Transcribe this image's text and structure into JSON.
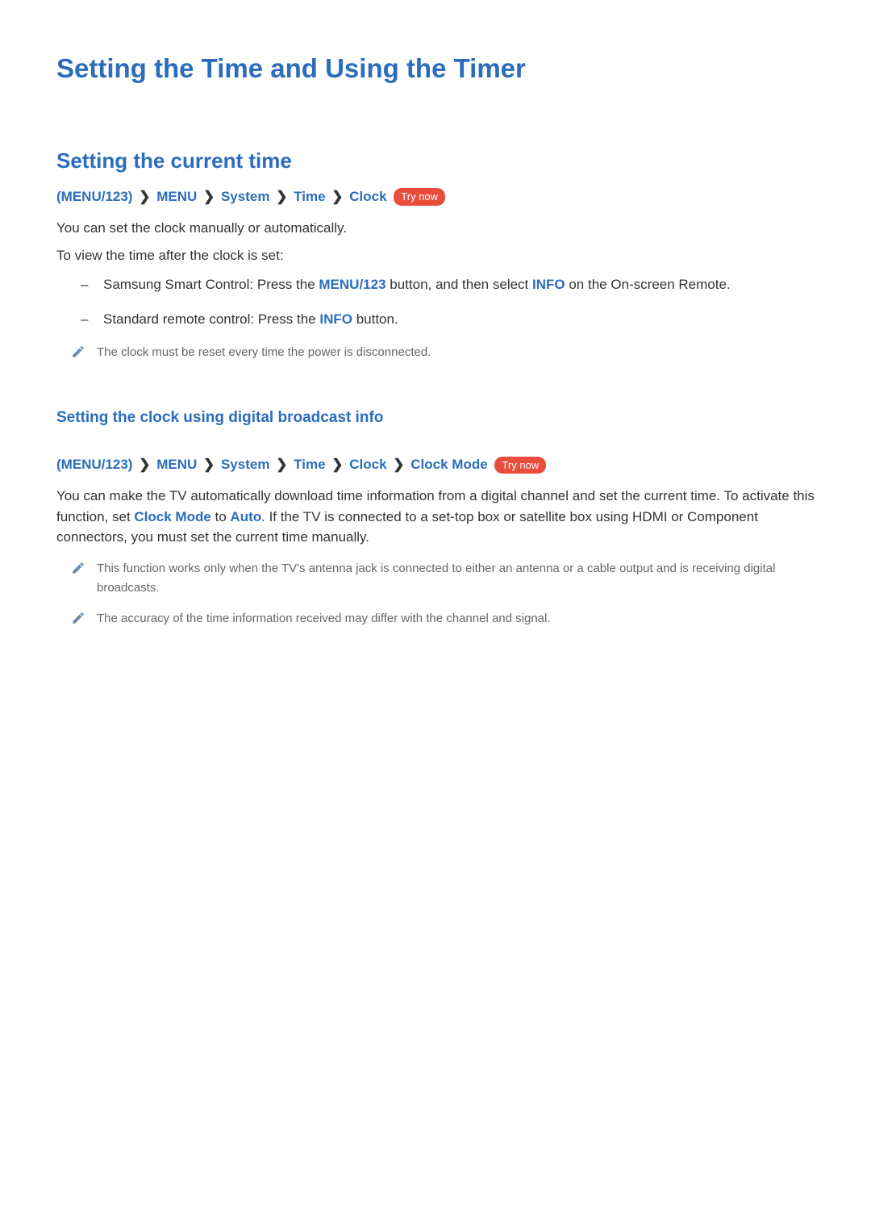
{
  "page": {
    "title": "Setting the Time and Using the Timer"
  },
  "section1": {
    "title": "Setting the current time",
    "breadcrumb": {
      "p1": "(MENU/123)",
      "p2": "MENU",
      "p3": "System",
      "p4": "Time",
      "p5": "Clock",
      "try_now": "Try now"
    },
    "intro1": "You can set the clock manually or automatically.",
    "intro2": "To view the time after the clock is set:",
    "bullets": [
      {
        "before": "Samsung Smart Control: Press the ",
        "blue1": "MENU/123",
        "mid": " button, and then select ",
        "blue2": "INFO",
        "after": " on the On-screen Remote."
      },
      {
        "before": "Standard remote control: Press the ",
        "blue1": "INFO",
        "after": " button."
      }
    ],
    "note1": "The clock must be reset every time the power is disconnected."
  },
  "section2": {
    "title": "Setting the clock using digital broadcast info",
    "breadcrumb": {
      "p1": "(MENU/123)",
      "p2": "MENU",
      "p3": "System",
      "p4": "Time",
      "p5": "Clock",
      "p6": "Clock Mode",
      "try_now": "Try now"
    },
    "para": {
      "t1": "You can make the TV automatically download time information from a digital channel and set the current time. To activate this function, set ",
      "b1": "Clock Mode",
      "t2": " to ",
      "b2": "Auto",
      "t3": ". If the TV is connected to a set-top box or satellite box using HDMI or Component connectors, you must set the current time manually."
    },
    "note1": "This function works only when the TV's antenna jack is connected to either an antenna or a cable output and is receiving digital broadcasts.",
    "note2": "The accuracy of the time information received may differ with the channel and signal."
  }
}
